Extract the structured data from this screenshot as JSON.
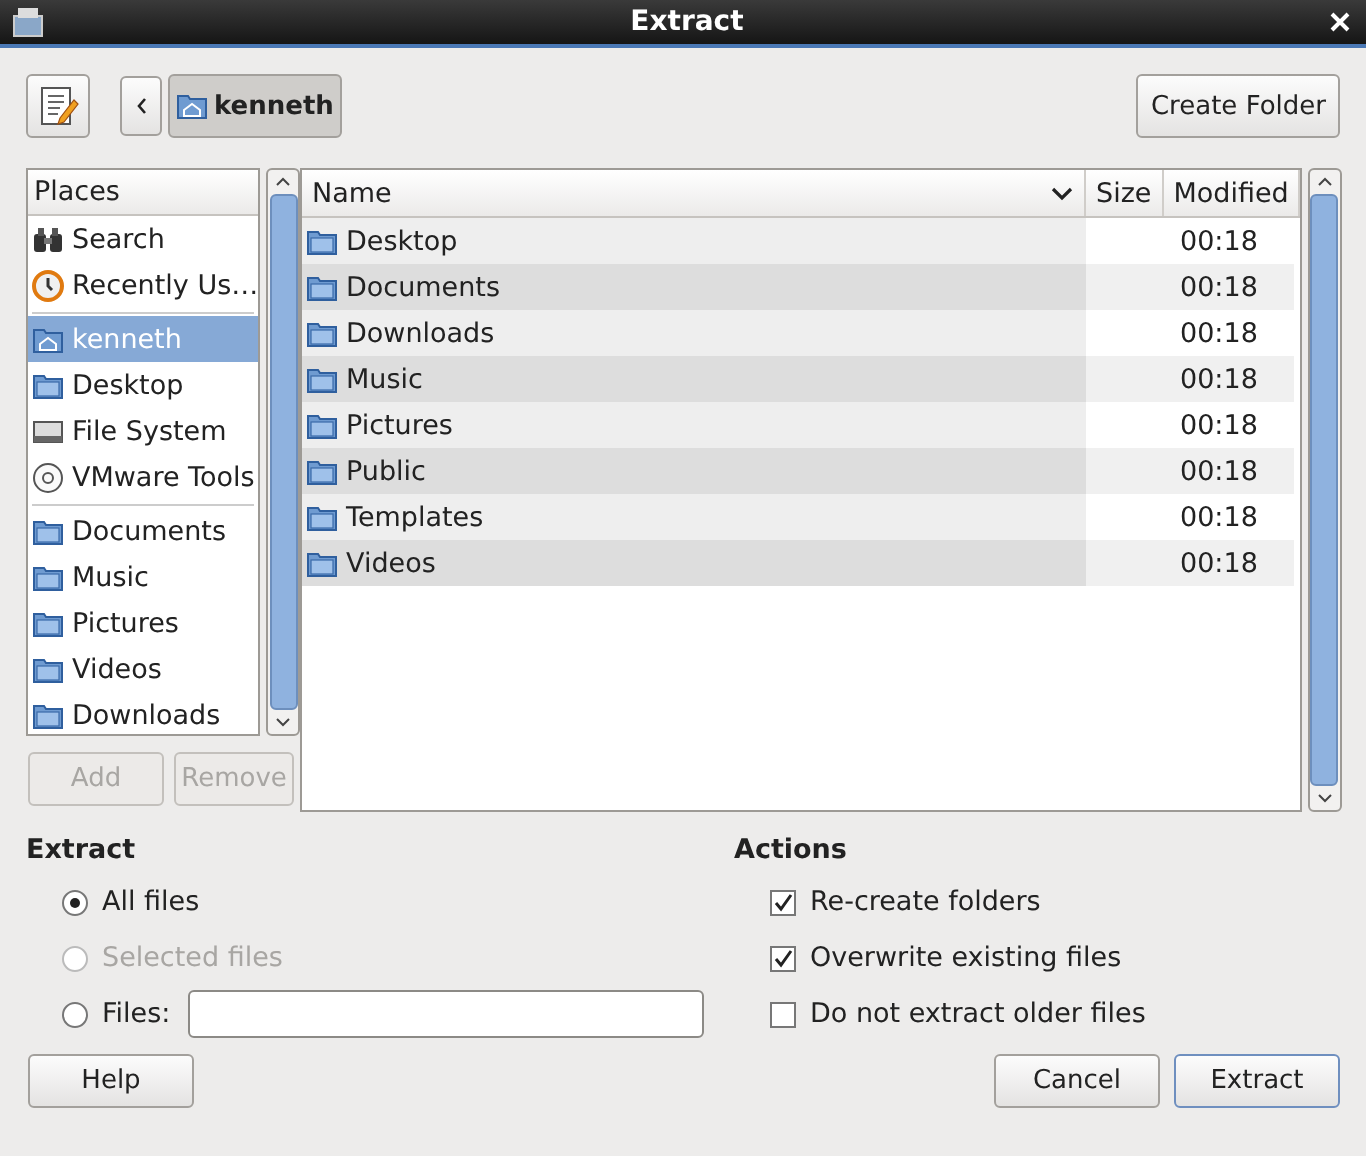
{
  "window": {
    "title": "Extract"
  },
  "toolbar": {
    "path": [
      {
        "label": "kenneth",
        "selected": true
      }
    ],
    "create_folder": "Create Folder"
  },
  "places": {
    "header": "Places",
    "groups": [
      [
        {
          "kind": "search",
          "label": "Search",
          "selected": false
        },
        {
          "kind": "recent",
          "label": "Recently Us…",
          "selected": false
        }
      ],
      [
        {
          "kind": "home",
          "label": "kenneth",
          "selected": true
        },
        {
          "kind": "folder",
          "label": "Desktop",
          "selected": false
        },
        {
          "kind": "drive",
          "label": "File System",
          "selected": false
        },
        {
          "kind": "disc",
          "label": "VMware Tools",
          "selected": false
        }
      ],
      [
        {
          "kind": "folder",
          "label": "Documents",
          "selected": false
        },
        {
          "kind": "folder",
          "label": "Music",
          "selected": false
        },
        {
          "kind": "folder",
          "label": "Pictures",
          "selected": false
        },
        {
          "kind": "folder",
          "label": "Videos",
          "selected": false
        },
        {
          "kind": "folder",
          "label": "Downloads",
          "selected": false
        }
      ]
    ],
    "buttons": [
      {
        "label": "Add",
        "disabled": true
      },
      {
        "label": "Remove",
        "disabled": true
      }
    ]
  },
  "files": {
    "columns": [
      {
        "label": "Name",
        "sorted": true
      },
      {
        "label": "Size",
        "sorted": false
      },
      {
        "label": "Modified",
        "sorted": false
      }
    ],
    "rows": [
      {
        "name": "Desktop",
        "modified": "00:18"
      },
      {
        "name": "Documents",
        "modified": "00:18"
      },
      {
        "name": "Downloads",
        "modified": "00:18"
      },
      {
        "name": "Music",
        "modified": "00:18"
      },
      {
        "name": "Pictures",
        "modified": "00:18"
      },
      {
        "name": "Public",
        "modified": "00:18"
      },
      {
        "name": "Templates",
        "modified": "00:18"
      },
      {
        "name": "Videos",
        "modified": "00:18"
      }
    ]
  },
  "extract": {
    "heading": "Extract",
    "options": [
      {
        "kind": "plain",
        "label": "All files",
        "selected": true,
        "disabled": false
      },
      {
        "kind": "plain",
        "label": "Selected files",
        "selected": false,
        "disabled": true
      },
      {
        "kind": "field",
        "label": "Files:",
        "selected": false,
        "disabled": false
      }
    ]
  },
  "actions": {
    "heading": "Actions",
    "options": [
      {
        "label": "Re-create folders",
        "checked": true
      },
      {
        "label": "Overwrite existing files",
        "checked": true
      },
      {
        "label": "Do not extract older files",
        "checked": false
      }
    ]
  },
  "buttons": [
    {
      "label": "Help",
      "default": false
    },
    {
      "label": "Cancel",
      "default": false
    },
    {
      "label": "Extract",
      "default": true
    }
  ]
}
